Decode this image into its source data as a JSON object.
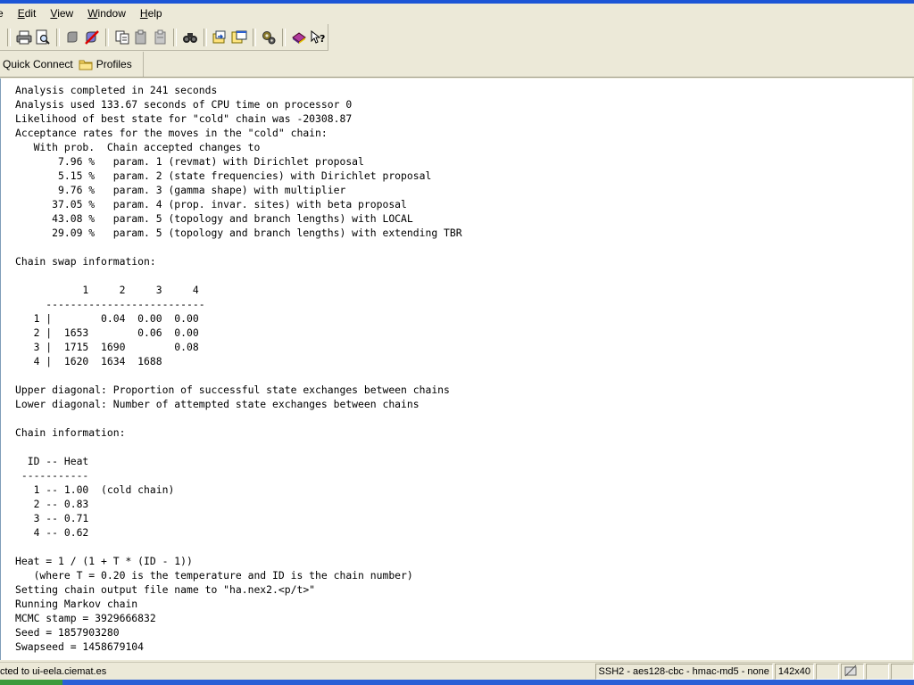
{
  "menu": {
    "items": [
      {
        "label": "e",
        "underline_index": -1
      },
      {
        "label": "Edit",
        "underline_index": 0
      },
      {
        "label": "View",
        "underline_index": 0
      },
      {
        "label": "Window",
        "underline_index": 0
      },
      {
        "label": "Help",
        "underline_index": 0
      }
    ]
  },
  "toolbar": {
    "icons": [
      "print-icon",
      "print-preview-icon",
      "disconnect-icon",
      "connect-icon",
      "copy-icon",
      "paste-icon",
      "paste-special-icon",
      "find-icon",
      "file-transfer-icon",
      "new-window-icon",
      "settings-icon",
      "help-book-icon",
      "whats-this-icon"
    ]
  },
  "quickbar": {
    "quick_connect": "Quick Connect",
    "profiles": "Profiles"
  },
  "terminal": {
    "lines": [
      "Analysis completed in 241 seconds",
      "Analysis used 133.67 seconds of CPU time on processor 0",
      "Likelihood of best state for \"cold\" chain was -20308.87",
      "Acceptance rates for the moves in the \"cold\" chain:",
      "   With prob.  Chain accepted changes to",
      "       7.96 %   param. 1 (revmat) with Dirichlet proposal",
      "       5.15 %   param. 2 (state frequencies) with Dirichlet proposal",
      "       9.76 %   param. 3 (gamma shape) with multiplier",
      "      37.05 %   param. 4 (prop. invar. sites) with beta proposal",
      "      43.08 %   param. 5 (topology and branch lengths) with LOCAL",
      "      29.09 %   param. 5 (topology and branch lengths) with extending TBR",
      "",
      "Chain swap information:",
      "",
      "           1     2     3     4",
      "     --------------------------",
      "   1 |        0.04  0.00  0.00",
      "   2 |  1653        0.06  0.00",
      "   3 |  1715  1690        0.08",
      "   4 |  1620  1634  1688",
      "",
      "Upper diagonal: Proportion of successful state exchanges between chains",
      "Lower diagonal: Number of attempted state exchanges between chains",
      "",
      "Chain information:",
      "",
      "  ID -- Heat",
      " -----------",
      "   1 -- 1.00  (cold chain)",
      "   2 -- 0.83",
      "   3 -- 0.71",
      "   4 -- 0.62",
      "",
      "Heat = 1 / (1 + T * (ID - 1))",
      "   (where T = 0.20 is the temperature and ID is the chain number)",
      "Setting chain output file name to \"ha.nex2.<p/t>\"",
      "Running Markov chain",
      "MCMC stamp = 3929666832",
      "Seed = 1857903280",
      "Swapseed = 1458679104"
    ]
  },
  "status": {
    "connection": "cted to ui-eela.ciemat.es",
    "cipher": "SSH2 - aes128-cbc - hmac-md5 - none",
    "size": "142x40"
  }
}
